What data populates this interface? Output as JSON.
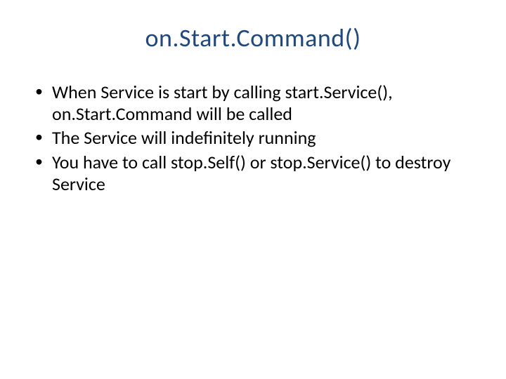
{
  "title": "on.Start.Command()",
  "bullets": [
    "When Service is start by calling start.Service(), on.Start.Command will be called",
    "The Service will indefinitely running",
    "You have to call stop.Self() or stop.Service() to destroy Service"
  ]
}
